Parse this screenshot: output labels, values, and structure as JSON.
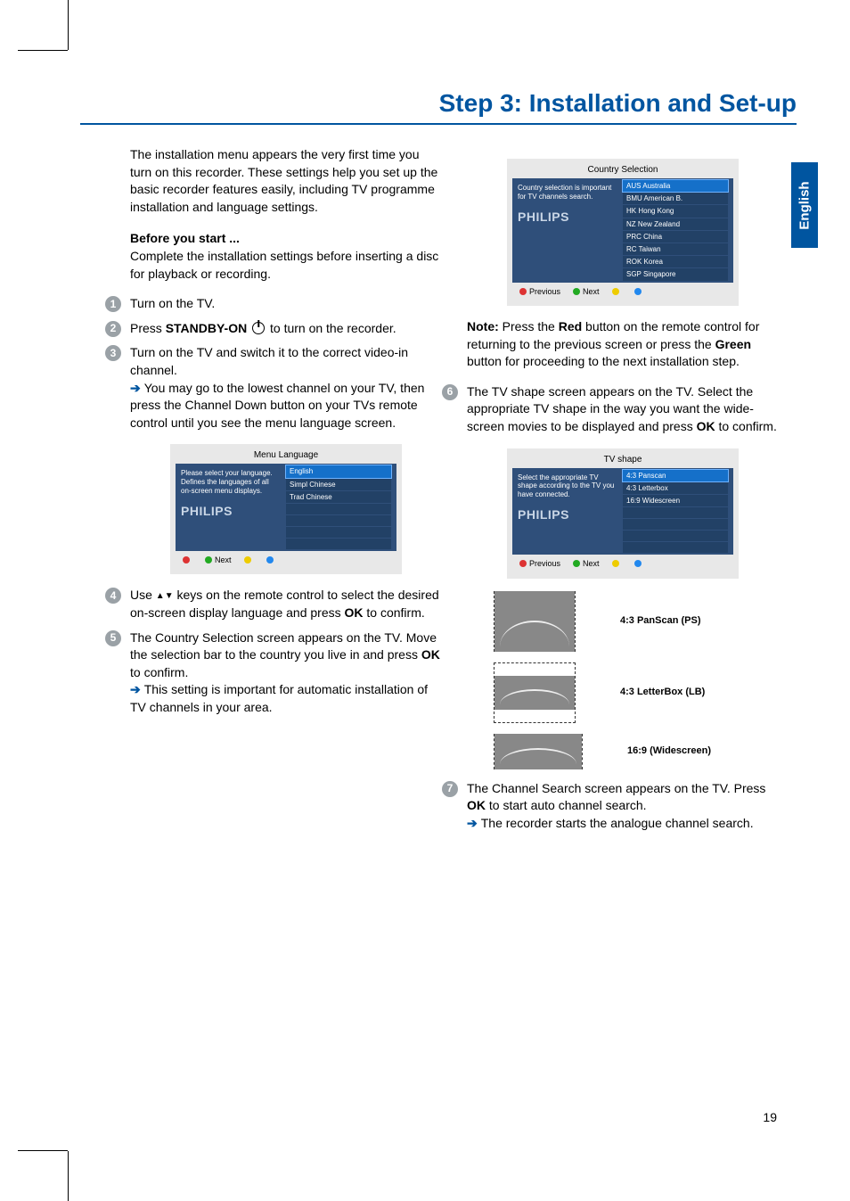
{
  "heading": "Step 3: Installation and Set-up",
  "language_tab": "English",
  "intro": "The installation menu appears the very first time you turn on this recorder. These settings help you set up the basic recorder features easily, including TV programme installation and language settings.",
  "before_label": "Before you start ...",
  "before_text": "Complete the installation settings before inserting a disc for playback or recording.",
  "steps": {
    "1": "Turn on the TV.",
    "2a": "Press ",
    "2b": "STANDBY-ON",
    "2c": " to turn on the recorder.",
    "3": "Turn on the TV and switch it to the correct video-in channel.",
    "3r": "You may go to the lowest channel on your TV, then press the Channel Down button on your TVs remote control until you see the menu language screen.",
    "4a": "Use ",
    "4b": " keys on the remote control to select the desired on-screen display language and press ",
    "4c": " to confirm.",
    "5a": "The Country Selection screen appears on the TV.  Move the selection bar to the country you live in and press ",
    "5b": " to confirm.",
    "5r": "This setting is important for automatic installation of TV channels in your area.",
    "note_a": "Note:",
    "note_b": " Press the ",
    "note_c": "Red",
    "note_d": " button on the remote control for returning to the previous screen or press the ",
    "note_e": "Green",
    "note_f": " button for proceeding to the next installation step.",
    "6a": "The TV shape screen appears on the TV.  Select the appropriate TV shape in the way you want the wide-screen movies to be displayed and press ",
    "6b": " to confirm.",
    "7a": "The Channel Search screen appears on the TV.  Press ",
    "7b": " to start auto channel search.",
    "7r": "The recorder starts the analogue channel search."
  },
  "ok_label": "OK",
  "osd_lang": {
    "title": "Menu Language",
    "help": "Please select your language. Defines the languages of all on-screen menu displays.",
    "brand": "PHILIPS",
    "items": [
      "English",
      "Simpl Chinese",
      "Trad Chinese"
    ],
    "next": "Next"
  },
  "osd_country": {
    "title": "Country Selection",
    "help": "Country selection is important for TV channels search.",
    "brand": "PHILIPS",
    "items": [
      "AUS  Australia",
      "BMU  American B.",
      "HK  Hong Kong",
      "NZ  New Zealand",
      "PRC  China",
      "RC  Taiwan",
      "ROK  Korea",
      "SGP  Singapore"
    ],
    "prev": "Previous",
    "next": "Next"
  },
  "osd_shape": {
    "title": "TV shape",
    "help": "Select the appropriate TV shape according to the TV you have connected.",
    "brand": "PHILIPS",
    "items": [
      "4:3 Panscan",
      "4:3 Letterbox",
      "16:9 Widescreen"
    ],
    "prev": "Previous",
    "next": "Next"
  },
  "shape_labels": {
    "ps": "4:3 PanScan (PS)",
    "lb": "4:3 LetterBox (LB)",
    "ws": "16:9 (Widescreen)"
  },
  "page_number": "19"
}
